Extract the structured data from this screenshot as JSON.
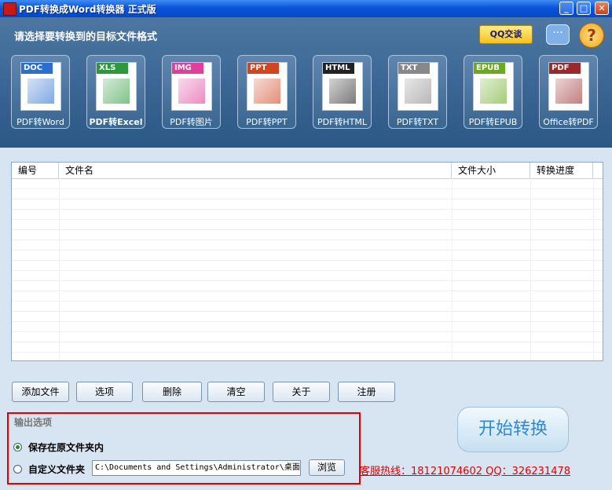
{
  "window": {
    "title": "PDF转换成Word转换器 正式版"
  },
  "header": {
    "prompt": "请选择要转换到的目标文件格式",
    "qq_label": "QQ交谈",
    "help_glyph": "?",
    "chat_glyph": "···"
  },
  "formats": [
    {
      "tag": "DOC",
      "label": "PDF转Word",
      "color": "#2a6fd0"
    },
    {
      "tag": "XLS",
      "label": "PDF转Excel",
      "color": "#2a9a3a",
      "active": true
    },
    {
      "tag": "IMG",
      "label": "PDF转图片",
      "color": "#e0409a"
    },
    {
      "tag": "PPT",
      "label": "PDF转PPT",
      "color": "#d2451f"
    },
    {
      "tag": "HTML",
      "label": "PDF转HTML",
      "color": "#222222"
    },
    {
      "tag": "TXT",
      "label": "PDF转TXT",
      "color": "#888888"
    },
    {
      "tag": "EPUB",
      "label": "PDF转EPUB",
      "color": "#6aaa1e"
    },
    {
      "tag": "PDF",
      "label": "Office转PDF",
      "color": "#9a2a2a"
    }
  ],
  "filelist": {
    "columns": [
      "编号",
      "文件名",
      "文件大小",
      "转换进度"
    ]
  },
  "buttons": {
    "add": "添加文件",
    "options": "选项",
    "delete": "删除",
    "clear": "清空",
    "about": "关于",
    "register": "注册"
  },
  "output": {
    "title": "输出选项",
    "keep_original": "保存在原文件夹内",
    "custom_folder": "自定义文件夹",
    "path": "C:\\Documents and Settings\\Administrator\\桌面",
    "browse": "浏览",
    "selected": "keep_original"
  },
  "start_button": "开始转换",
  "hotline": "客服热线：18121074602 QQ：326231478"
}
